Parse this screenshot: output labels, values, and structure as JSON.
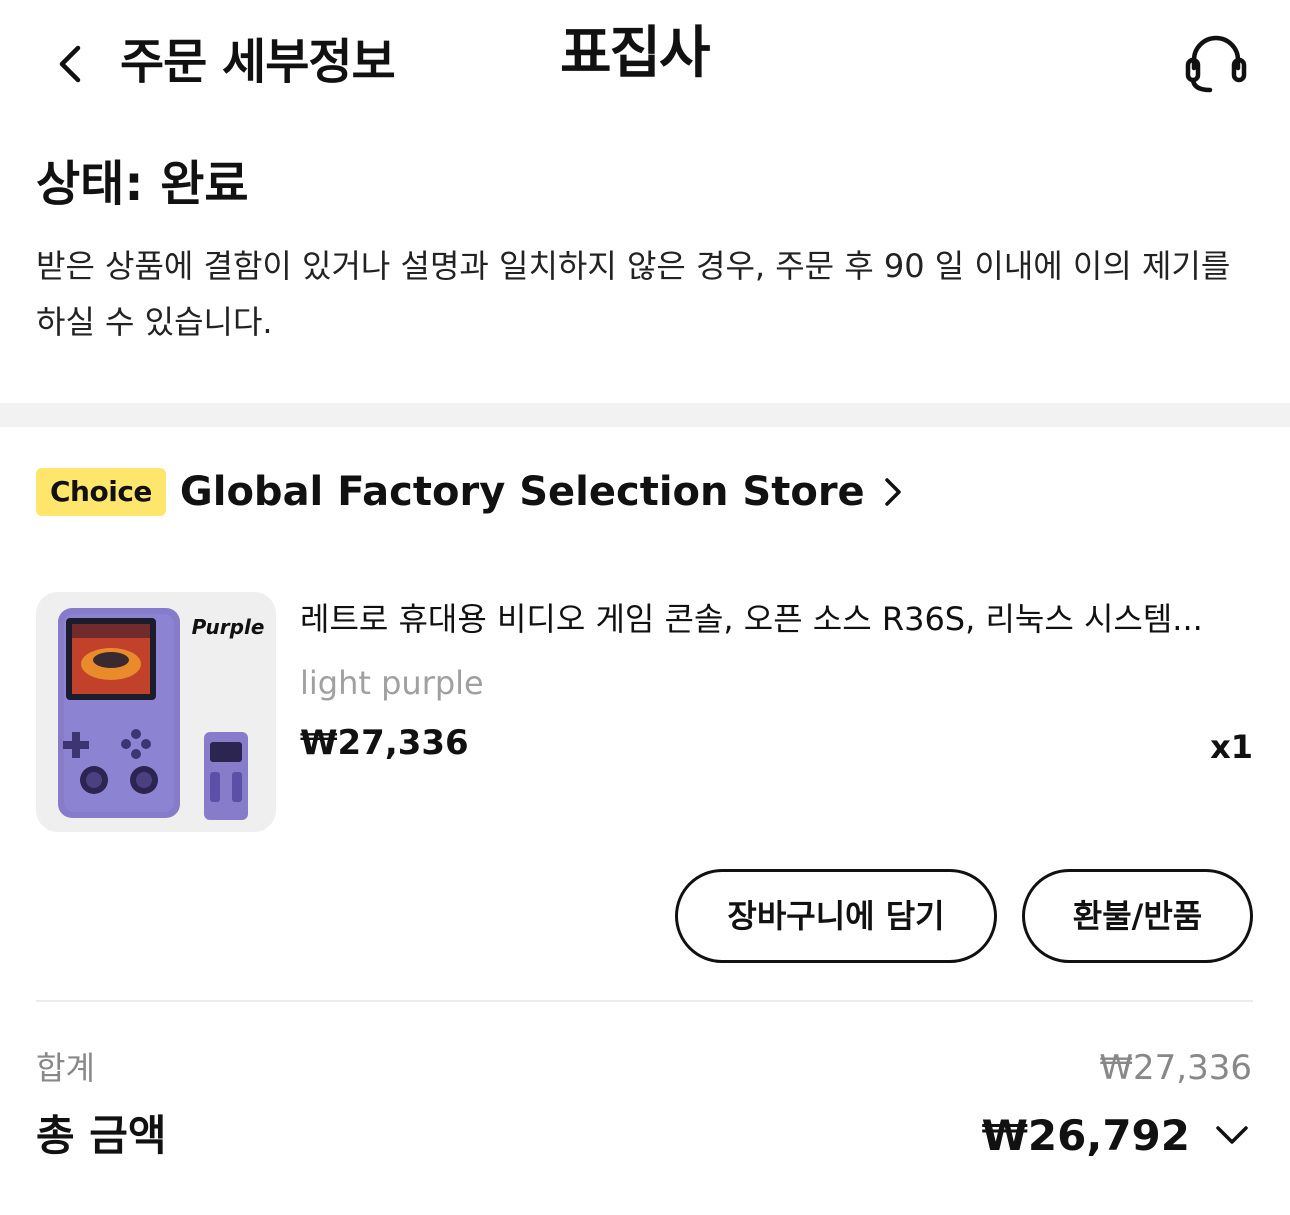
{
  "header": {
    "title": "주문 세부정보",
    "brand": "표집사",
    "back_icon": "chevron-left-icon",
    "support_icon": "headset-icon"
  },
  "status": {
    "title": "상태: 완료",
    "description": "받은 상품에 결함이 있거나 설명과 일치하지 않은 경우, 주문 후 90 일 이내에 이의 제기를 하실 수 있습니다."
  },
  "store": {
    "badge": "Choice",
    "badge_color": "#fde66b",
    "name": "Global Factory Selection Store",
    "chevron_icon": "chevron-right-icon"
  },
  "product": {
    "title": "레트로 휴대용 비디오 게임 콘솔, 오픈 소스 R36S, 리눅스 시스템...",
    "image_label": "Purple",
    "variant": "light purple",
    "price": "₩27,336",
    "quantity": "x1"
  },
  "actions": {
    "add_to_cart": "장바구니에 담기",
    "refund_return": "환불/반품"
  },
  "summary": {
    "subtotal_label": "합계",
    "subtotal_value": "₩27,336",
    "total_label": "총 금액",
    "total_value": "₩26,792",
    "expand_icon": "chevron-down-icon"
  }
}
